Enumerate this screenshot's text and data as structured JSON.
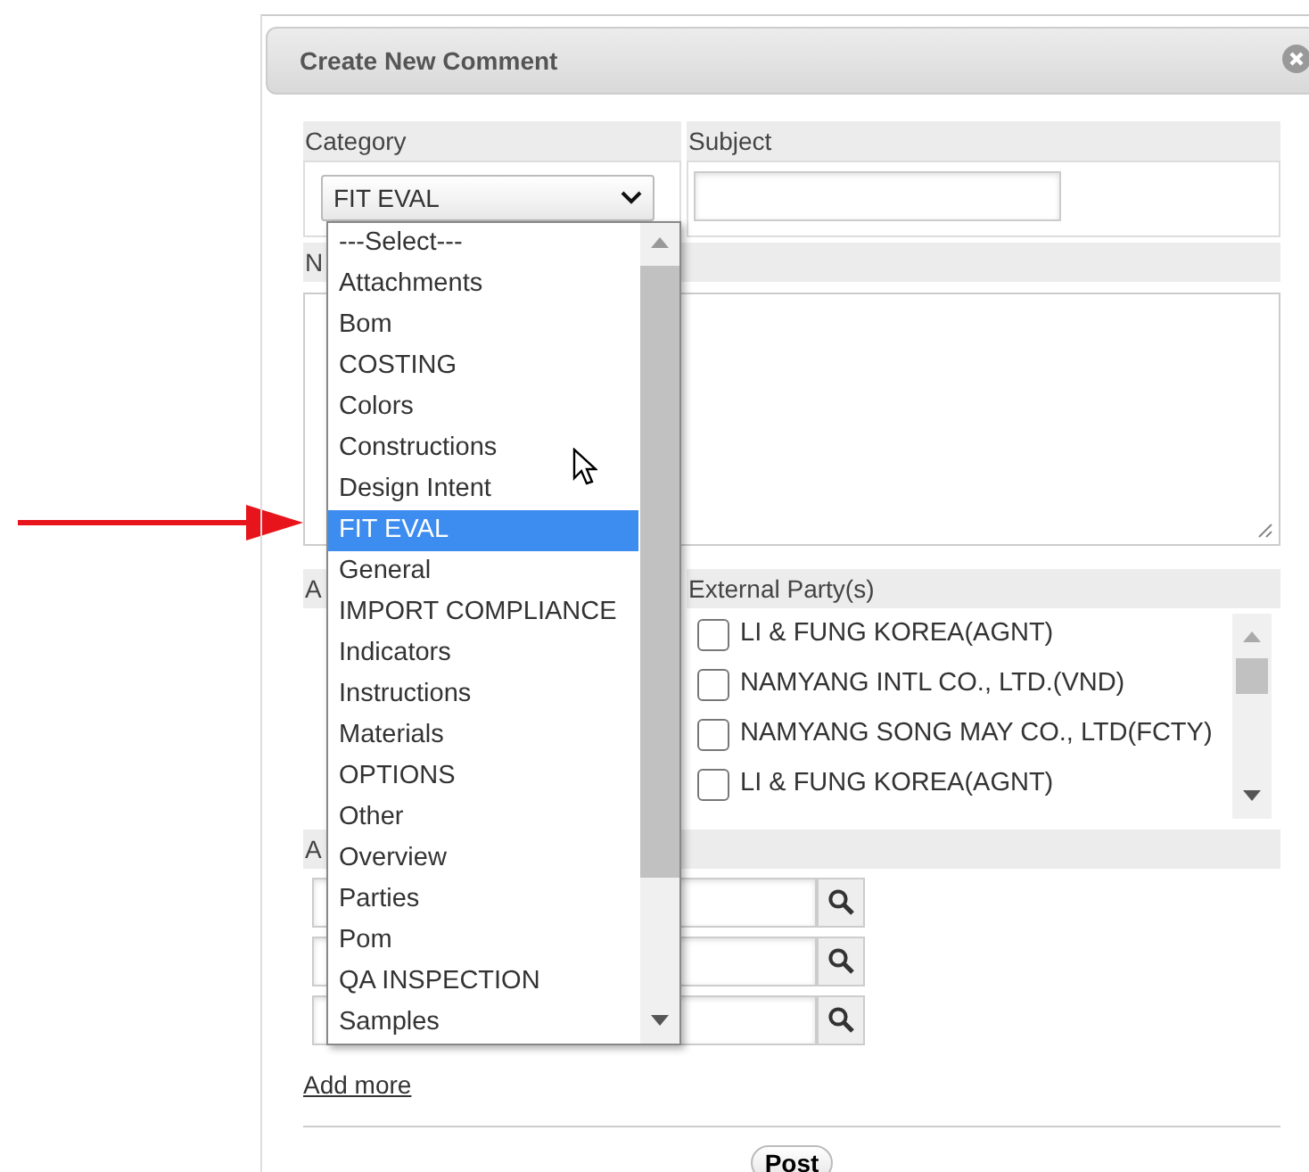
{
  "dialog": {
    "title": "Create New Comment"
  },
  "category": {
    "label": "Category",
    "value": "FIT EVAL",
    "expanded": true,
    "options": [
      {
        "label": "---Select---",
        "selected": false
      },
      {
        "label": "Attachments",
        "selected": false
      },
      {
        "label": "Bom",
        "selected": false
      },
      {
        "label": "COSTING",
        "selected": false
      },
      {
        "label": "Colors",
        "selected": false
      },
      {
        "label": "Constructions",
        "selected": false
      },
      {
        "label": "Design Intent",
        "selected": false
      },
      {
        "label": "FIT EVAL",
        "selected": true
      },
      {
        "label": "General",
        "selected": false
      },
      {
        "label": "IMPORT COMPLIANCE",
        "selected": false
      },
      {
        "label": "Indicators",
        "selected": false
      },
      {
        "label": "Instructions",
        "selected": false
      },
      {
        "label": "Materials",
        "selected": false
      },
      {
        "label": "OPTIONS",
        "selected": false
      },
      {
        "label": "Other",
        "selected": false
      },
      {
        "label": "Overview",
        "selected": false
      },
      {
        "label": "Parties",
        "selected": false
      },
      {
        "label": "Pom",
        "selected": false
      },
      {
        "label": "QA INSPECTION",
        "selected": false
      },
      {
        "label": "Samples",
        "selected": false
      }
    ]
  },
  "subject": {
    "label": "Subject"
  },
  "notes": {
    "label": "N"
  },
  "internal_parties": {
    "label": "A"
  },
  "external_parties": {
    "label": "External Party(s)",
    "rows": [
      {
        "name": "LI & FUNG KOREA(AGNT)",
        "checked": false
      },
      {
        "name": "NAMYANG INTL CO., LTD.(VND)",
        "checked": false
      },
      {
        "name": "NAMYANG SONG MAY CO., LTD(FCTY)",
        "checked": false
      },
      {
        "name": "LI & FUNG KOREA(AGNT)",
        "checked": false
      }
    ]
  },
  "attachments": {
    "label": "A",
    "rows": [
      {
        "kind": "file"
      },
      {
        "kind": "file"
      },
      {
        "kind": "file"
      }
    ]
  },
  "add_more": "Add more",
  "post_button": "Post"
}
